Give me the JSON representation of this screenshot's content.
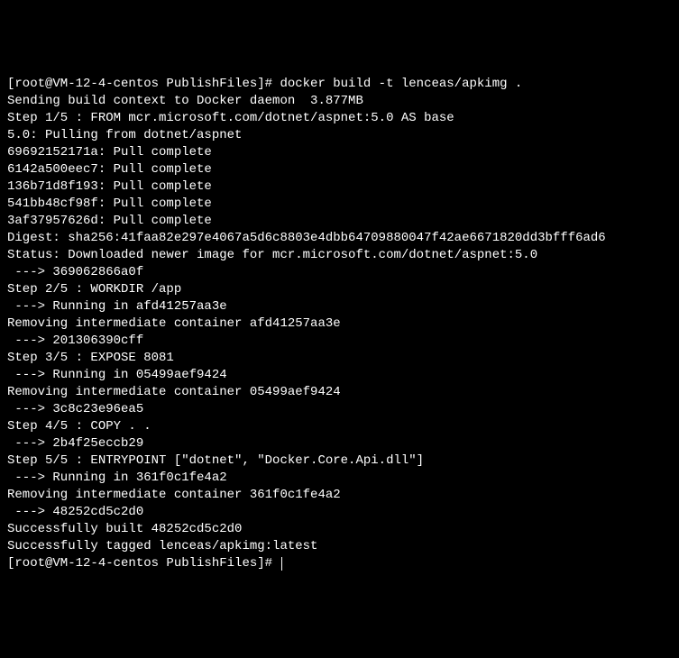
{
  "terminal": {
    "lines": [
      "[root@VM-12-4-centos PublishFiles]# docker build -t lenceas/apkimg .",
      "Sending build context to Docker daemon  3.877MB",
      "Step 1/5 : FROM mcr.microsoft.com/dotnet/aspnet:5.0 AS base",
      "5.0: Pulling from dotnet/aspnet",
      "69692152171a: Pull complete",
      "6142a500eec7: Pull complete",
      "136b71d8f193: Pull complete",
      "541bb48cf98f: Pull complete",
      "3af37957626d: Pull complete",
      "Digest: sha256:41faa82e297e4067a5d6c8803e4dbb64709880047f42ae6671820dd3bfff6ad6",
      "Status: Downloaded newer image for mcr.microsoft.com/dotnet/aspnet:5.0",
      " ---> 369062866a0f",
      "Step 2/5 : WORKDIR /app",
      " ---> Running in afd41257aa3e",
      "Removing intermediate container afd41257aa3e",
      " ---> 201306390cff",
      "Step 3/5 : EXPOSE 8081",
      " ---> Running in 05499aef9424",
      "Removing intermediate container 05499aef9424",
      " ---> 3c8c23e96ea5",
      "Step 4/5 : COPY . .",
      " ---> 2b4f25eccb29",
      "Step 5/5 : ENTRYPOINT [\"dotnet\", \"Docker.Core.Api.dll\"]",
      " ---> Running in 361f0c1fe4a2",
      "Removing intermediate container 361f0c1fe4a2",
      " ---> 48252cd5c2d0",
      "Successfully built 48252cd5c2d0",
      "Successfully tagged lenceas/apkimg:latest",
      "[root@VM-12-4-centos PublishFiles]# "
    ]
  }
}
